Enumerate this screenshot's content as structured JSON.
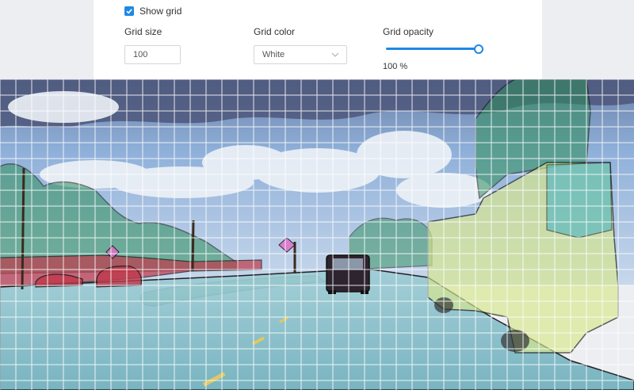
{
  "controls": {
    "show_grid": {
      "label": "Show grid",
      "checked": true
    },
    "grid_size": {
      "label": "Grid size",
      "value": "100"
    },
    "grid_color": {
      "label": "Grid color",
      "value": "White"
    },
    "grid_opacity": {
      "label": "Grid opacity",
      "value": "100 %",
      "level": 1.0
    }
  },
  "colors": {
    "accent": "#1e88e5",
    "grid_line": "#ffffff",
    "road_overlay": "#7ec8d8",
    "vegetation_overlay": "#2f8f5b",
    "vehicle_overlay": "#d8e88a",
    "building_overlay": "#c0384a",
    "sign_overlay": "#e070c8"
  },
  "icons": {
    "checkbox": "check-icon",
    "select": "chevron-down-icon"
  }
}
